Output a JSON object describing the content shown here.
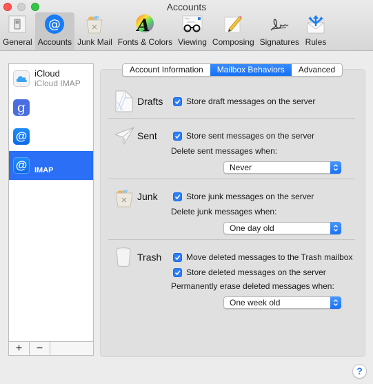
{
  "window": {
    "title": "Accounts"
  },
  "toolbar": {
    "items": [
      {
        "label": "General",
        "icon": "switch-icon"
      },
      {
        "label": "Accounts",
        "icon": "at-icon",
        "selected": true
      },
      {
        "label": "Junk Mail",
        "icon": "junk-basket-icon"
      },
      {
        "label": "Fonts & Colors",
        "icon": "color-wheel-icon"
      },
      {
        "label": "Viewing",
        "icon": "glasses-icon"
      },
      {
        "label": "Composing",
        "icon": "pencil-icon"
      },
      {
        "label": "Signatures",
        "icon": "signature-icon"
      },
      {
        "label": "Rules",
        "icon": "rules-envelope-icon"
      }
    ]
  },
  "accounts": {
    "items": [
      {
        "name": "iCloud",
        "sub": "iCloud IMAP",
        "icon": "icloud-icon"
      },
      {
        "name": "",
        "sub": "",
        "icon": "google-icon"
      },
      {
        "name": "",
        "sub": "",
        "icon": "at-icon"
      },
      {
        "name": "",
        "sub": "IMAP",
        "icon": "at-icon",
        "selected": true
      }
    ],
    "add_label": "+",
    "remove_label": "−"
  },
  "tabs": {
    "items": [
      "Account Information",
      "Mailbox Behaviors",
      "Advanced"
    ],
    "active": "Mailbox Behaviors"
  },
  "sections": {
    "drafts": {
      "title": "Drafts",
      "store_label": "Store draft messages on the server",
      "store_checked": true
    },
    "sent": {
      "title": "Sent",
      "store_label": "Store sent messages on the server",
      "store_checked": true,
      "delete_label": "Delete sent messages when:",
      "delete_value": "Never"
    },
    "junk": {
      "title": "Junk",
      "store_label": "Store junk messages on the server",
      "store_checked": true,
      "delete_label": "Delete junk messages when:",
      "delete_value": "One day old"
    },
    "trash": {
      "title": "Trash",
      "move_label": "Move deleted messages to the Trash mailbox",
      "move_checked": true,
      "store_label": "Store deleted messages on the server",
      "store_checked": true,
      "erase_label": "Permanently erase deleted messages when:",
      "erase_value": "One week old"
    }
  },
  "help": {
    "label": "?"
  },
  "colors": {
    "accent": "#2a6ff5",
    "checkbox": "#2c7ef8"
  }
}
